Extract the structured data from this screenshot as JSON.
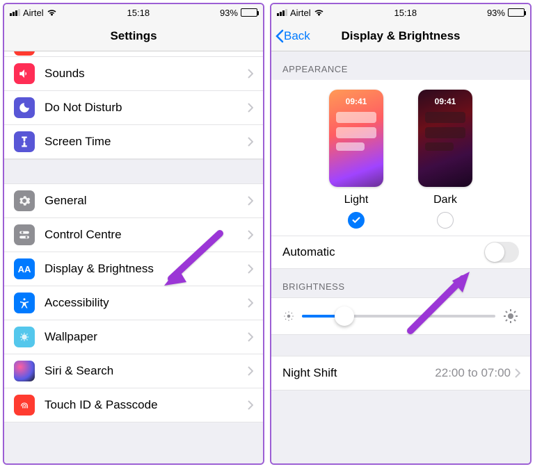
{
  "statusbar": {
    "carrier": "Airtel",
    "time": "15:18",
    "battery_pct": "93%"
  },
  "left": {
    "title": "Settings",
    "group1": [
      {
        "label": "Sounds",
        "iconColor": "#ff2d55",
        "iconName": "sounds-icon"
      },
      {
        "label": "Do Not Disturb",
        "iconColor": "#5856d6",
        "iconName": "dnd-icon"
      },
      {
        "label": "Screen Time",
        "iconColor": "#5856d6",
        "iconName": "screentime-icon"
      }
    ],
    "group2": [
      {
        "label": "General",
        "iconColor": "#8e8e93",
        "iconName": "general-icon"
      },
      {
        "label": "Control Centre",
        "iconColor": "#8e8e93",
        "iconName": "control-centre-icon"
      },
      {
        "label": "Display & Brightness",
        "iconColor": "#007aff",
        "iconName": "display-icon"
      },
      {
        "label": "Accessibility",
        "iconColor": "#007aff",
        "iconName": "accessibility-icon"
      },
      {
        "label": "Wallpaper",
        "iconColor": "#54c7ec",
        "iconName": "wallpaper-icon"
      },
      {
        "label": "Siri & Search",
        "iconColor": "#1c1c1e",
        "iconName": "siri-icon"
      },
      {
        "label": "Touch ID & Passcode",
        "iconColor": "#ff3b30",
        "iconName": "touchid-icon"
      }
    ]
  },
  "right": {
    "back": "Back",
    "title": "Display & Brightness",
    "appearance_header": "Appearance",
    "light_label": "Light",
    "dark_label": "Dark",
    "mini_time": "09:41",
    "selected": "light",
    "automatic_label": "Automatic",
    "automatic_on": false,
    "brightness_header": "Brightness",
    "night_shift_label": "Night Shift",
    "night_shift_value": "22:00 to 07:00"
  },
  "arrow_color": "#9b36d6"
}
